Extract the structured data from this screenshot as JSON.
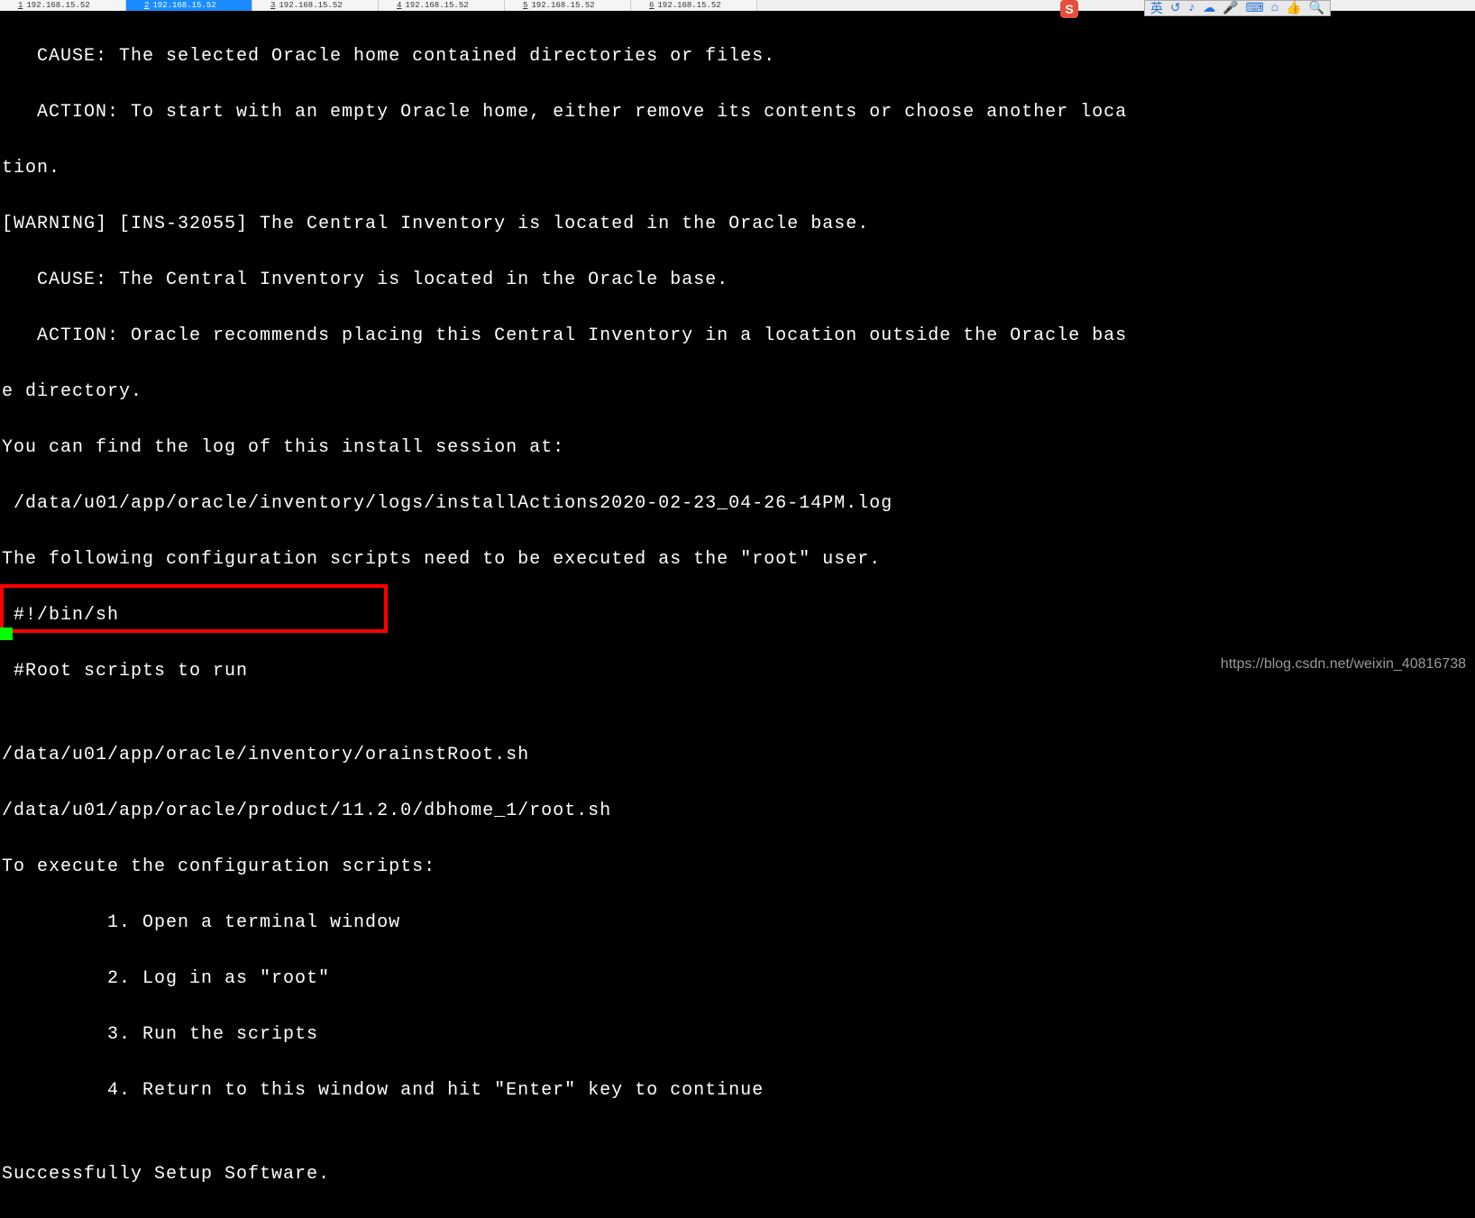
{
  "tabs": [
    {
      "num": "1",
      "label": "192.168.15.52"
    },
    {
      "num": "2",
      "label": "192.168.15.52"
    },
    {
      "num": "3",
      "label": "192.168.15.52"
    },
    {
      "num": "4",
      "label": "192.168.15.52"
    },
    {
      "num": "5",
      "label": "192.168.15.52"
    },
    {
      "num": "6",
      "label": "192.168.15.52"
    }
  ],
  "s_label": "S",
  "toolbar_icons": [
    "英",
    "↺",
    "♪",
    "☁",
    "🎤",
    "⌨",
    "⌂",
    "👍",
    "🔍"
  ],
  "term": {
    "l1": "   CAUSE: The selected Oracle home contained directories or files.",
    "l2": "   ACTION: To start with an empty Oracle home, either remove its contents or choose another loca",
    "l3": "tion.",
    "l4": "[WARNING] [INS-32055] The Central Inventory is located in the Oracle base.",
    "l5": "   CAUSE: The Central Inventory is located in the Oracle base.",
    "l6": "   ACTION: Oracle recommends placing this Central Inventory in a location outside the Oracle bas",
    "l7": "e directory.",
    "l8": "You can find the log of this install session at:",
    "l9": " /data/u01/app/oracle/inventory/logs/installActions2020-02-23_04-26-14PM.log",
    "l10": "The following configuration scripts need to be executed as the \"root\" user.",
    "l11": " #!/bin/sh ",
    "l12": " #Root scripts to run",
    "l13": "",
    "l14": "/data/u01/app/oracle/inventory/orainstRoot.sh",
    "l15": "/data/u01/app/oracle/product/11.2.0/dbhome_1/root.sh",
    "l16": "To execute the configuration scripts:",
    "l17": "         1. Open a terminal window",
    "l18": "         2. Log in as \"root\"",
    "l19": "         3. Run the scripts",
    "l20": "         4. Return to this window and hit \"Enter\" key to continue",
    "l21": "",
    "l22": "Successfully Setup Software."
  },
  "watermark": "https://blog.csdn.net/weixin_40816738"
}
